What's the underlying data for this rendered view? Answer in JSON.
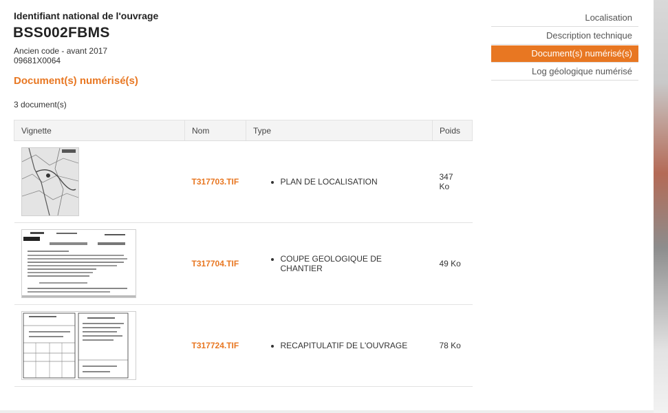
{
  "header": {
    "label": "Identifiant national de l'ouvrage",
    "bss_code": "BSS002FBMS",
    "old_code_label": "Ancien code - avant 2017",
    "old_code": "09681X0064"
  },
  "section": {
    "title": "Document(s) numérisé(s)",
    "count": "3 document(s)"
  },
  "table": {
    "columns": [
      "Vignette",
      "Nom",
      "Type",
      "Poids"
    ],
    "rows": [
      {
        "name": "T317703.TIF",
        "type": "PLAN DE LOCALISATION",
        "size": "347 Ko",
        "thumb": "map-thumbnail"
      },
      {
        "name": "T317704.TIF",
        "type": "COUPE GEOLOGIQUE DE CHANTIER",
        "size": "49 Ko",
        "thumb": "geologic-log-thumbnail"
      },
      {
        "name": "T317724.TIF",
        "type": "RECAPITULATIF DE L'OUVRAGE",
        "size": "78 Ko",
        "thumb": "form-thumbnail"
      }
    ]
  },
  "nav": {
    "items": [
      {
        "label": "Localisation"
      },
      {
        "label": "Description technique"
      },
      {
        "label": "Document(s) numérisé(s)"
      },
      {
        "label": "Log géologique numérisé"
      }
    ],
    "active_index": 2
  },
  "colors": {
    "accent": "#e87722",
    "header_bg": "#f4f4f4"
  }
}
